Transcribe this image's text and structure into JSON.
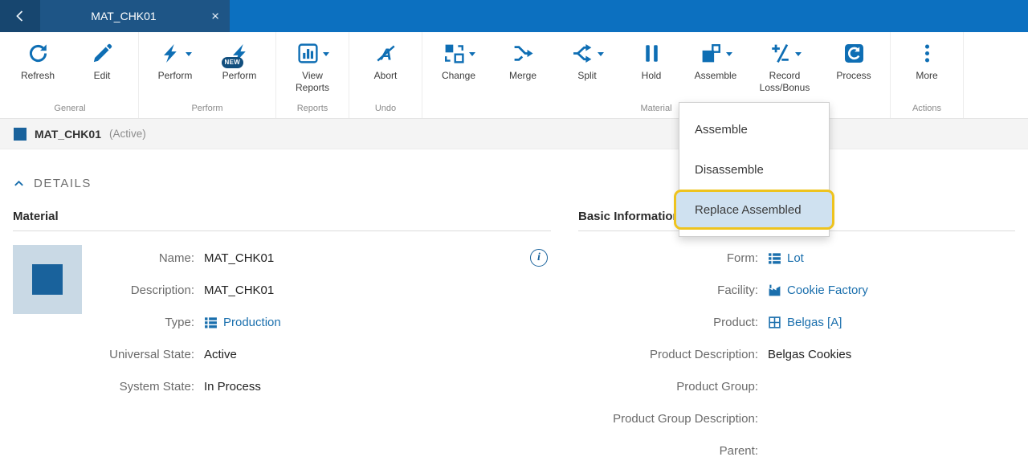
{
  "titlebar": {
    "tab_title": "MAT_CHK01",
    "close_glyph": "×"
  },
  "ribbon": {
    "groups": [
      {
        "label": "General",
        "buttons": [
          {
            "label": "Refresh"
          },
          {
            "label": "Edit"
          }
        ]
      },
      {
        "label": "Perform",
        "buttons": [
          {
            "label": "Perform"
          },
          {
            "label": "Perform",
            "badge": "NEW"
          }
        ]
      },
      {
        "label": "Reports",
        "buttons": [
          {
            "label": "View Reports"
          }
        ]
      },
      {
        "label": "Undo",
        "buttons": [
          {
            "label": "Abort"
          }
        ]
      },
      {
        "label": "Material",
        "buttons": [
          {
            "label": "Change"
          },
          {
            "label": "Merge"
          },
          {
            "label": "Split"
          },
          {
            "label": "Hold"
          },
          {
            "label": "Assemble"
          },
          {
            "label": "Record Loss/Bonus"
          },
          {
            "label": "Process"
          }
        ]
      },
      {
        "label": "Actions",
        "buttons": [
          {
            "label": "More"
          }
        ]
      }
    ]
  },
  "status": {
    "name": "MAT_CHK01",
    "state": "(Active)"
  },
  "details": {
    "title": "DETAILS"
  },
  "material": {
    "title": "Material",
    "info_glyph": "i",
    "fields": [
      {
        "label": "Name:",
        "value": "MAT_CHK01"
      },
      {
        "label": "Description:",
        "value": "MAT_CHK01"
      },
      {
        "label": "Type:",
        "value": "Production"
      },
      {
        "label": "Universal State:",
        "value": "Active"
      },
      {
        "label": "System State:",
        "value": "In Process"
      }
    ]
  },
  "basic": {
    "title": "Basic Information",
    "fields": [
      {
        "label": "Form:",
        "value": "Lot"
      },
      {
        "label": "Facility:",
        "value": "Cookie Factory"
      },
      {
        "label": "Product:",
        "value": "Belgas [A]"
      },
      {
        "label": "Product Description:",
        "value": "Belgas Cookies"
      },
      {
        "label": "Product Group:",
        "value": ""
      },
      {
        "label": "Product Group Description:",
        "value": ""
      },
      {
        "label": "Parent:",
        "value": ""
      }
    ]
  },
  "assemble_menu": {
    "items": [
      {
        "label": "Assemble"
      },
      {
        "label": "Disassemble"
      },
      {
        "label": "Replace Assembled",
        "highlighted": true
      }
    ]
  },
  "colors": {
    "accent": "#0e6eb4",
    "link": "#1a6fad",
    "highlight_ring": "#eec31e",
    "topbar": "#0c70c0"
  }
}
